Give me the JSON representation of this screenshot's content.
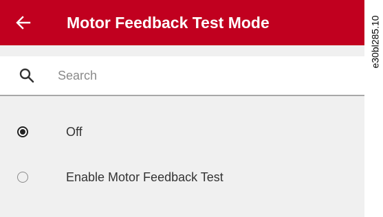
{
  "header": {
    "title": "Motor Feedback Test Mode",
    "back_icon": "arrow-left-icon",
    "background_color": "#c1001f"
  },
  "search": {
    "icon": "search-icon",
    "placeholder": "Search",
    "value": ""
  },
  "options": [
    {
      "label": "Off",
      "selected": true
    },
    {
      "label": "Enable Motor Feedback Test",
      "selected": false
    }
  ],
  "figure_id": "e30bl285.10"
}
